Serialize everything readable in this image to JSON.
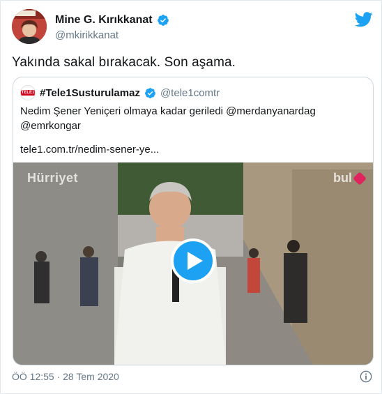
{
  "author": {
    "name": "Mine G. Kırıkkanat",
    "handle": "@mkirikkanat",
    "avatar_icon": "profile-photo"
  },
  "tweet": {
    "text": "Yakında sakal bırakacak. Son aşama."
  },
  "quoted_tweet": {
    "name": "#Tele1Susturulamaz",
    "handle": "@tele1comtr",
    "avatar_text": "TELE1",
    "text": "Nedim Şener Yeniçeri olmaya kadar geriledi @merdanyanardag @emrkongar",
    "link": "tele1.com.tr/nedim-sener-ye...",
    "video": {
      "watermark_left": "Hürriyet",
      "watermark_right": "bul",
      "play_icon": "play-icon"
    }
  },
  "footer": {
    "timestamp": "ÖÖ 12:55 · 28 Tem 2020"
  },
  "colors": {
    "twitter_blue": "#1da1f2",
    "verified_blue": "#1da1f2",
    "muted_text": "#657786"
  }
}
